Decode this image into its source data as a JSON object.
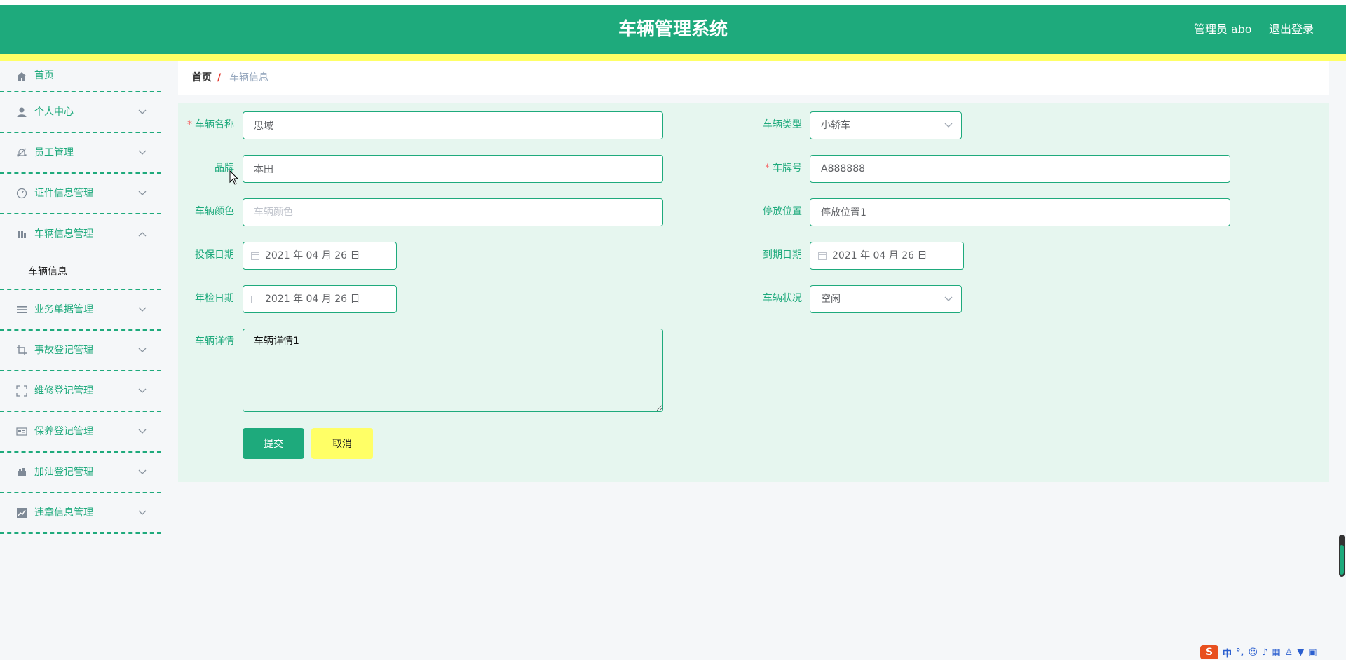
{
  "header": {
    "title": "车辆管理系统",
    "user": "管理员 abo",
    "logout": "退出登录",
    "brand_color": "#1eaa7c",
    "accent_color": "#ffff66"
  },
  "sidebar": {
    "items": [
      {
        "label": "首页",
        "icon": "home-icon"
      },
      {
        "label": "个人中心",
        "icon": "user-icon"
      },
      {
        "label": "员工管理",
        "icon": "bell-off-icon"
      },
      {
        "label": "证件信息管理",
        "icon": "gauge-icon"
      },
      {
        "label": "车辆信息管理",
        "icon": "building-icon",
        "expanded": true
      },
      {
        "label": "业务单据管理",
        "icon": "list-icon"
      },
      {
        "label": "事故登记管理",
        "icon": "crop-icon"
      },
      {
        "label": "维修登记管理",
        "icon": "fullscreen-icon"
      },
      {
        "label": "保养登记管理",
        "icon": "card-icon"
      },
      {
        "label": "加油登记管理",
        "icon": "fuel-icon"
      },
      {
        "label": "违章信息管理",
        "icon": "chart-icon"
      }
    ],
    "sub_item": "车辆信息"
  },
  "breadcrumb": {
    "home": "首页",
    "separator": "/",
    "current": "车辆信息"
  },
  "form": {
    "vehicle_name": {
      "label": "车辆名称",
      "value": "思域",
      "required": true
    },
    "vehicle_type": {
      "label": "车辆类型",
      "value": "小轿车"
    },
    "brand": {
      "label": "品牌",
      "value": "本田"
    },
    "plate": {
      "label": "车牌号",
      "value": "A888888",
      "required": true
    },
    "color": {
      "label": "车辆颜色",
      "placeholder": "车辆颜色",
      "value": ""
    },
    "parking": {
      "label": "停放位置",
      "value": "停放位置1"
    },
    "insure_date": {
      "label": "投保日期",
      "value": "2021 年 04 月 26 日"
    },
    "expire_date": {
      "label": "到期日期",
      "value": "2021 年 04 月 26 日"
    },
    "inspect_date": {
      "label": "年检日期",
      "value": "2021 年 04 月 26 日"
    },
    "status": {
      "label": "车辆状况",
      "value": "空闲"
    },
    "detail": {
      "label": "车辆详情",
      "value": "车辆详情1"
    },
    "submit": "提交",
    "cancel": "取消"
  },
  "ime": {
    "logo": "S",
    "lang": "中"
  }
}
